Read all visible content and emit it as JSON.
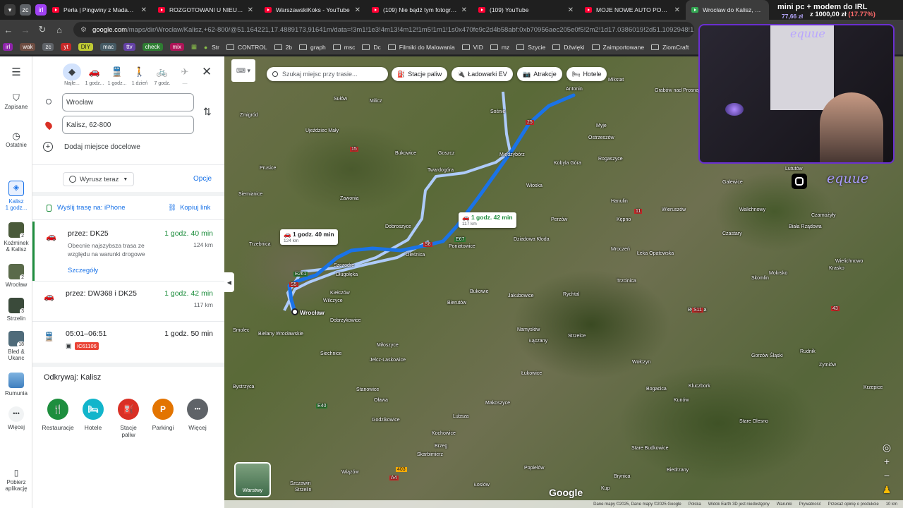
{
  "browser": {
    "tabs": [
      {
        "title": "Perła | Pingwiny z Madagaskaru",
        "active": false
      },
      {
        "title": "ROZGOTOWANI U NIEUCZESANYCH",
        "active": false
      },
      {
        "title": "WarszawskiKoks - YouTube",
        "active": false
      },
      {
        "title": "(109) Nie bądź tym fotografem",
        "active": false
      },
      {
        "title": "(109) YouTube",
        "active": false
      },
      {
        "title": "MOJE NOWE AUTO POTRZEBUJE",
        "active": false
      },
      {
        "title": "Wrocław do Kalisz, 62-800",
        "active": true
      }
    ],
    "url_host": "google.com",
    "url_path": "/maps/dir/Wrocław/Kalisz,+62-800/@51.164221,17.4889173,91641m/data=!3m1!1e3!4m13!4m12!1m5!1m1!1s0x470fe9c2d4b58abf:0xb70956aec205e0f5!2m2!1d17.0386019!2d51.1092948!1m5!1m1",
    "bookmarks": [
      "irl",
      "wak",
      "zc",
      "yt",
      "DIY",
      "mac",
      "ttv",
      "check",
      "mix",
      "Str",
      "CONTROL",
      "2b",
      "graph",
      "msc",
      "Dc",
      "Filmiki do Malowania",
      "VID",
      "mz",
      "Szycie",
      "Dźwięki",
      "Zaimportowane",
      "ZiomCraft"
    ]
  },
  "rail": {
    "saved": "Zapisane",
    "recent": "Ostatnie",
    "item1": "Kalisz\n1 godz...",
    "item2": "Koźminek\n& Kalisz",
    "item3": "Wrocław",
    "item4": "Strzelin",
    "item5": "Bled &\nUkanc",
    "item6": "Rumunia",
    "more": "Więcej",
    "get_app": "Pobierz\naplikację",
    "counts": {
      "item2": "2",
      "item3": "2",
      "item4": "3",
      "item5": "18"
    }
  },
  "panel": {
    "modes": [
      {
        "label": "Najle...",
        "icon": "◆",
        "selected": true
      },
      {
        "label": "1 godz...",
        "icon": "🚗",
        "selected": false
      },
      {
        "label": "1 godz...",
        "icon": "🚆",
        "selected": false
      },
      {
        "label": "1 dzień",
        "icon": "🚶",
        "selected": false
      },
      {
        "label": "7 godz.",
        "icon": "🚲",
        "selected": false
      },
      {
        "label": "—",
        "icon": "✈",
        "selected": false
      }
    ],
    "origin": "Wrocław",
    "destination": "Kalisz, 62-800",
    "add_destination": "Dodaj miejsce docelowe",
    "leave_now": "Wyrusz teraz",
    "options": "Opcje",
    "send_to_phone": "Wyślij trasę na: iPhone",
    "copy_link": "Kopiuj link",
    "routes": [
      {
        "via": "przez: DK25",
        "time": "1 godz. 40 min",
        "distance": "124 km",
        "note": "Obecnie najszybsza trasa ze względu na warunki drogowe",
        "details": "Szczegóły"
      },
      {
        "via": "przez: DW368 i DK25",
        "time": "1 godz. 42 min",
        "distance": "117 km"
      },
      {
        "via": "05:01–06:51",
        "time": "1 godz. 50 min",
        "badge": "IC61106"
      }
    ],
    "discover_title": "Odkrywaj: Kalisz",
    "pois": [
      {
        "label": "Restauracje",
        "icon": "🍴",
        "color": "#1e8e3e"
      },
      {
        "label": "Hotele",
        "icon": "🛏",
        "color": "#12b5cb"
      },
      {
        "label": "Stacje\npaliw",
        "icon": "⛽",
        "color": "#d93025"
      },
      {
        "label": "Parkingi",
        "icon": "P",
        "color": "#e37400"
      },
      {
        "label": "Więcej",
        "icon": "•••",
        "color": "#5f6368"
      }
    ]
  },
  "map": {
    "search_placeholder": "Szukaj miejsc przy trasie...",
    "chips": [
      {
        "label": "Stacje paliw",
        "icon": "⛽"
      },
      {
        "label": "Ładowarki EV",
        "icon": "🔌"
      },
      {
        "label": "Atrakcje",
        "icon": "📷"
      },
      {
        "label": "Hotele",
        "icon": "🛏"
      }
    ],
    "route_box_1": {
      "time": "1 godz. 40 min",
      "dist": "124 km"
    },
    "route_box_2": {
      "time": "1 godz. 42 min",
      "dist": "117 km"
    },
    "layers": "Warstwy",
    "google": "Google",
    "footer": [
      "Dane mapy ©2025, Dane mapy ©2025 Google",
      "Polska",
      "Widok Earth 3D jest niedostępny",
      "Warunki",
      "Prywatność",
      "Przekaż opinię o produkcie",
      "10 km"
    ],
    "places": [
      "Antonin",
      "Mikstat",
      "Sułów",
      "Milicz",
      "Grabów nad Prosną",
      "Zmigród",
      "Sośnie",
      "Ujeździec Mały",
      "Międzybórz",
      "Myje",
      "Ostrzeszów",
      "Goszcz",
      "Twardogóra",
      "Kobyla Góra",
      "Rogaszyce",
      "Prusice",
      "Bukowice",
      "Wioska",
      "Zawonia",
      "Perzów",
      "Hanulin",
      "Wieruszów",
      "Galewice",
      "Siemianice",
      "Trzebnica",
      "Dobroszyce",
      "Dziadowa Kłoda",
      "Mroczeń",
      "Bierutów",
      "Poniatowice",
      "Oleśnica",
      "Szczodre",
      "Długołęka",
      "Kiełczów",
      "Wilczyce",
      "Wrocław",
      "Dobrzykowice",
      "Bukowie",
      "Jakubowice",
      "Rychtal",
      "Trzcinica",
      "Byczyna",
      "Łeka Opatowska",
      "Smolec",
      "Bielany Wrocławskie",
      "Siechnice",
      "Namysłów",
      "Łączany",
      "Strzelce",
      "Wołczyn",
      "Kluczbork",
      "Kunów",
      "Miłoszyce",
      "Jelcz-Laskowice",
      "Bystrzyca",
      "Stanowice",
      "Oława",
      "Łukowice",
      "Bogacica",
      "Makoszyce",
      "Godzikowice",
      "Lubsza",
      "Kochowice",
      "Stare Olesno",
      "Brzeg",
      "Skarbimierz",
      "Stare Budkowice",
      "Popielów",
      "Wiązów",
      "Łosiów",
      "Biedrzany",
      "Kup",
      "Brynica",
      "Szczawin",
      "Strzelin",
      "Lututów",
      "Czarnożyły",
      "Walichnowy",
      "Biała Rządowa",
      "Czastary",
      "Mokrsko",
      "Skomlin",
      "Wielichnowo",
      "Krasko",
      "Gorzów Śląski",
      "Rudnik",
      "Zytniów",
      "Krzepice",
      "Kępno"
    ],
    "roads": [
      "25",
      "15",
      "E67",
      "S8",
      "E261",
      "S5",
      "E40",
      "A4",
      "403",
      "11",
      "43",
      "S11"
    ]
  },
  "stream": {
    "goal": "mini pc + modem do IRL",
    "raised": "77,66 zł",
    "target": "z 1000,00 zł",
    "percent": "(17.77%)",
    "brand": "equue",
    "handle": "equue"
  }
}
